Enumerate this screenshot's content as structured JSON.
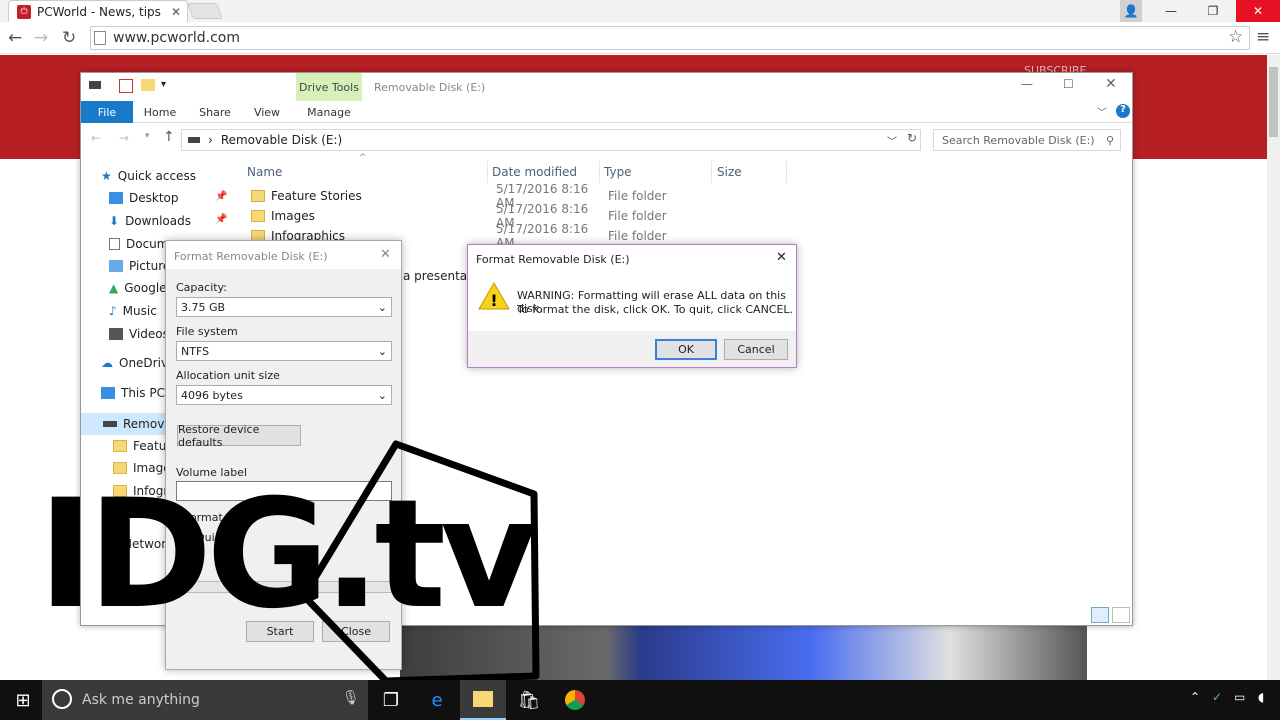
{
  "browser": {
    "tab_title": "PCWorld - News, tips and",
    "url": "www.pcworld.com",
    "subscribe": "SUBSCRIBE"
  },
  "explorer": {
    "title": "Removable Disk (E:)",
    "contextual_tab": "Drive Tools",
    "tabs": [
      "File",
      "Home",
      "Share",
      "View",
      "Manage"
    ],
    "address": "Removable Disk (E:)",
    "search_placeholder": "Search Removable Disk (E:)",
    "nav": [
      {
        "label": "Quick access",
        "icon": "star-icon"
      },
      {
        "label": "Desktop",
        "icon": "desktop-icon"
      },
      {
        "label": "Downloads",
        "icon": "download-icon"
      },
      {
        "label": "Documents",
        "icon": "document-icon"
      },
      {
        "label": "Pictures",
        "icon": "pictures-icon"
      },
      {
        "label": "Google",
        "icon": "google-drive-icon"
      },
      {
        "label": "Music",
        "icon": "music-icon"
      },
      {
        "label": "Videos",
        "icon": "videos-icon"
      },
      {
        "label": "OneDrive",
        "icon": "cloud-icon"
      },
      {
        "label": "This PC",
        "icon": "computer-icon"
      },
      {
        "label": "Removable",
        "icon": "drive-icon"
      },
      {
        "label": "Feature",
        "icon": "folder-icon"
      },
      {
        "label": "Images",
        "icon": "folder-icon"
      },
      {
        "label": "Infogra",
        "icon": "folder-icon"
      },
      {
        "label": "Network",
        "icon": "network-icon"
      }
    ],
    "columns": [
      "Name",
      "Date modified",
      "Type",
      "Size"
    ],
    "files": [
      {
        "name": "Feature Stories",
        "date": "5/17/2016 8:16 AM",
        "type": "File folder"
      },
      {
        "name": "Images",
        "date": "5/17/2016 8:16 AM",
        "type": "File folder"
      },
      {
        "name": "Infographics",
        "date": "5/17/2016 8:16 AM",
        "type": "File folder"
      }
    ],
    "partial_file": "a presentatio"
  },
  "format_dialog": {
    "title": "Format Removable Disk (E:)",
    "capacity_label": "Capacity:",
    "capacity": "3.75 GB",
    "fs_label": "File system",
    "fs": "NTFS",
    "alloc_label": "Allocation unit size",
    "alloc": "4096 bytes",
    "restore": "Restore device defaults",
    "volume_label": "Volume label",
    "format_options": "Format op",
    "quick": "Quick",
    "start": "Start",
    "close": "Close"
  },
  "warning_dialog": {
    "title": "Format Removable Disk (E:)",
    "line1": "WARNING: Formatting will erase ALL data on this disk.",
    "line2": "To format the disk, click OK. To quit, click CANCEL.",
    "ok": "OK",
    "cancel": "Cancel"
  },
  "taskbar": {
    "search": "Ask me anything"
  },
  "watermark": "IDG.tv"
}
